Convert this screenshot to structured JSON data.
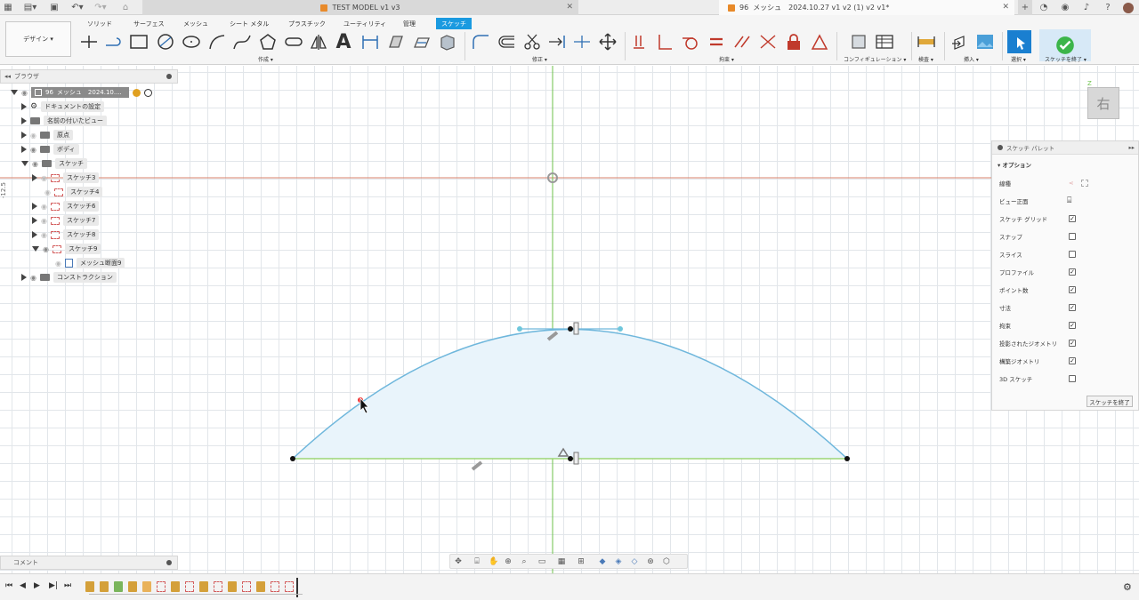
{
  "window": {
    "main_tab_title": "TEST MODEL v1 v3",
    "mesh_tab_number": "96",
    "mesh_tab_title": "メッシュ　2024.10.27 v1 v2 (1) v2 v1*"
  },
  "ribbon": {
    "tabs": [
      "ソリッド",
      "サーフェス",
      "メッシュ",
      "シート メタル",
      "プラスチック",
      "ユーティリティ",
      "管理",
      "スケッチ"
    ],
    "active_tab": "スケッチ",
    "workspace": "デザイン",
    "groups": {
      "create": "作成",
      "modify": "修正",
      "constraints": "拘束",
      "configure": "コンフィギュレーション",
      "inspect": "検査",
      "insert": "挿入",
      "select": "選択",
      "finish": "スケッチを終了"
    }
  },
  "browser": {
    "title": "ブラウザ",
    "root_num": "96",
    "root": "メッシュ　2024.10....",
    "items": [
      {
        "label": "ドキュメントの設定"
      },
      {
        "label": "名前の付いたビュー"
      },
      {
        "label": "原点"
      },
      {
        "label": "ボディ"
      },
      {
        "label": "スケッチ"
      },
      {
        "label": "スケッチ3"
      },
      {
        "label": "スケッチ4"
      },
      {
        "label": "スケッチ6"
      },
      {
        "label": "スケッチ7"
      },
      {
        "label": "スケッチ8"
      },
      {
        "label": "スケッチ9"
      },
      {
        "label": "メッシュ断面9"
      },
      {
        "label": "コンストラクション"
      }
    ]
  },
  "ruler_label": "-12.5",
  "comments": {
    "title": "コメント"
  },
  "viewcube": {
    "face": "右"
  },
  "palette": {
    "title": "スケッチ パレット",
    "section": "オプション",
    "rows": [
      {
        "label": "線種",
        "checked": null
      },
      {
        "label": "ビュー正面",
        "checked": null
      },
      {
        "label": "スケッチ グリッド",
        "checked": true
      },
      {
        "label": "スナップ",
        "checked": false
      },
      {
        "label": "スライス",
        "checked": false
      },
      {
        "label": "プロファイル",
        "checked": true
      },
      {
        "label": "ポイント数",
        "checked": true
      },
      {
        "label": "寸法",
        "checked": true
      },
      {
        "label": "拘束",
        "checked": true
      },
      {
        "label": "投影されたジオメトリ",
        "checked": true
      },
      {
        "label": "構築ジオメトリ",
        "checked": true
      },
      {
        "label": "3D スケッチ",
        "checked": false
      }
    ],
    "finish_button": "スケッチを終了"
  },
  "colors": {
    "accent": "#1a9ae0",
    "sketch_curve": "#6fb7dc",
    "profile_fill": "#e9f4fb",
    "axis_green": "#6cc24a",
    "axis_red": "#d9826b",
    "finish_green": "#3cb54a"
  }
}
